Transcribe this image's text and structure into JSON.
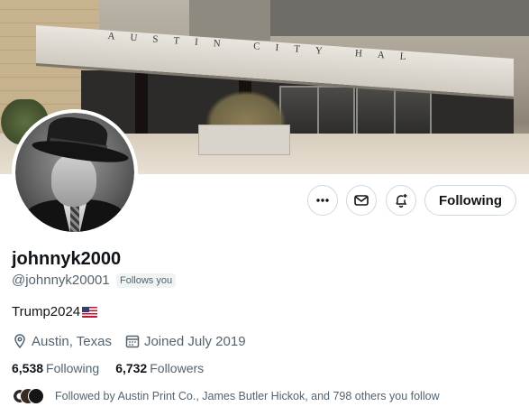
{
  "banner": {
    "sign_text": "AUSTIN CITY HAL"
  },
  "profile": {
    "display_name": "johnnyk2000",
    "handle": "@johnnyk20001",
    "follows_you_badge": "Follows you",
    "bio": "Trump2024",
    "location": "Austin, Texas",
    "joined": "Joined July 2019",
    "following_count": "6,538",
    "following_label": "Following",
    "followers_count": "6,732",
    "followers_label": "Followers",
    "followed_by": "Followed by Austin Print Co., James Butler Hickok, and 798 others you follow"
  },
  "actions": {
    "more_icon": "more-dots-icon",
    "message_icon": "envelope-icon",
    "notify_icon": "bell-plus-icon",
    "following_button": "Following"
  },
  "colors": {
    "text_primary": "#0f1419",
    "text_secondary": "#536471",
    "border": "#cfd9de",
    "badge_bg": "#eff3f4"
  }
}
